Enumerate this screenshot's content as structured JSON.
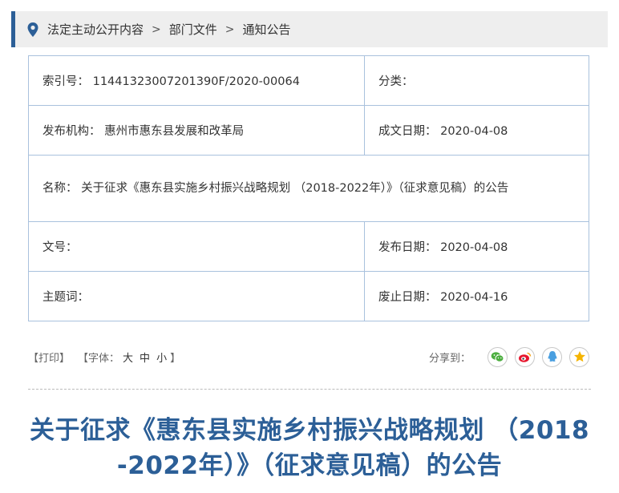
{
  "breadcrumb": {
    "items": [
      "法定主动公开内容",
      "部门文件",
      "通知公告"
    ],
    "separator": ">"
  },
  "meta": {
    "index_label": "索引号：",
    "index_value": "11441323007201390F/2020-00064",
    "category_label": "分类：",
    "category_value": "",
    "publisher_label": "发布机构：",
    "publisher_value": "惠州市惠东县发展和改革局",
    "created_label": "成文日期：",
    "created_value": "2020-04-08",
    "name_label": "名称：",
    "name_value": "关于征求《惠东县实施乡村振兴战略规划 （2018-2022年）》（征求意见稿）的公告",
    "docno_label": "文号：",
    "docno_value": "",
    "published_label": "发布日期：",
    "published_value": "2020-04-08",
    "subject_label": "主题词：",
    "subject_value": "",
    "expire_label": "废止日期：",
    "expire_value": "2020-04-16"
  },
  "tools": {
    "print_label": "【打印】",
    "font_label": "【字体：",
    "font_large": "大",
    "font_medium": "中",
    "font_small": "小",
    "font_close": "】",
    "share_label": "分享到："
  },
  "share_icons": [
    "wechat-icon",
    "weibo-icon",
    "qq-icon",
    "qzone-icon"
  ],
  "headline": {
    "line1": "关于征求《惠东县实施乡村振兴战略规划 （2018",
    "line2": "-2022年）》（征求意见稿）的公告"
  },
  "colors": {
    "brand": "#2c5f97",
    "table_border": "#a9c1dd",
    "wechat": "#4cae3f",
    "weibo": "#e6162d",
    "qq": "#4a9fe0",
    "qzone": "#f5b400"
  }
}
